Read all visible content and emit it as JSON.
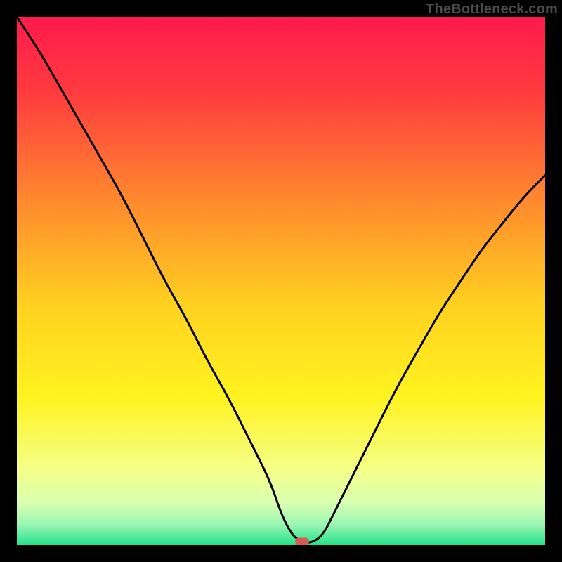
{
  "watermark": "TheBottleneck.com",
  "colors": {
    "gradient_stops": [
      {
        "pct": 0,
        "color": "#ff1a4b"
      },
      {
        "pct": 14,
        "color": "#ff3a3f"
      },
      {
        "pct": 35,
        "color": "#ff8a2e"
      },
      {
        "pct": 55,
        "color": "#ffd21f"
      },
      {
        "pct": 72,
        "color": "#fff31f"
      },
      {
        "pct": 86,
        "color": "#f4ff8a"
      },
      {
        "pct": 92,
        "color": "#d8ffb0"
      },
      {
        "pct": 96,
        "color": "#9cf7b4"
      },
      {
        "pct": 100,
        "color": "#23e28b"
      }
    ],
    "curve": "#000000",
    "marker": "#d65a56",
    "frame": "#000000"
  },
  "chart_data": {
    "type": "line",
    "title": "",
    "xlabel": "",
    "ylabel": "",
    "xlim": [
      0,
      100
    ],
    "ylim": [
      0,
      100
    ],
    "marker": {
      "x": 54,
      "y": 0.6
    },
    "series": [
      {
        "name": "bottleneck-curve",
        "x": [
          0,
          4,
          8,
          12,
          16,
          20,
          24,
          28,
          32,
          36,
          40,
          44,
          48,
          50,
          52,
          54,
          56,
          58,
          60,
          64,
          68,
          72,
          76,
          80,
          84,
          88,
          92,
          96,
          100
        ],
        "values": [
          100,
          94,
          87,
          80,
          73,
          66,
          58,
          50,
          43,
          35,
          28,
          20,
          12,
          6,
          2,
          0.5,
          0.5,
          2,
          6,
          14,
          22,
          30,
          37,
          44,
          50,
          56,
          61,
          66,
          70
        ]
      }
    ]
  }
}
